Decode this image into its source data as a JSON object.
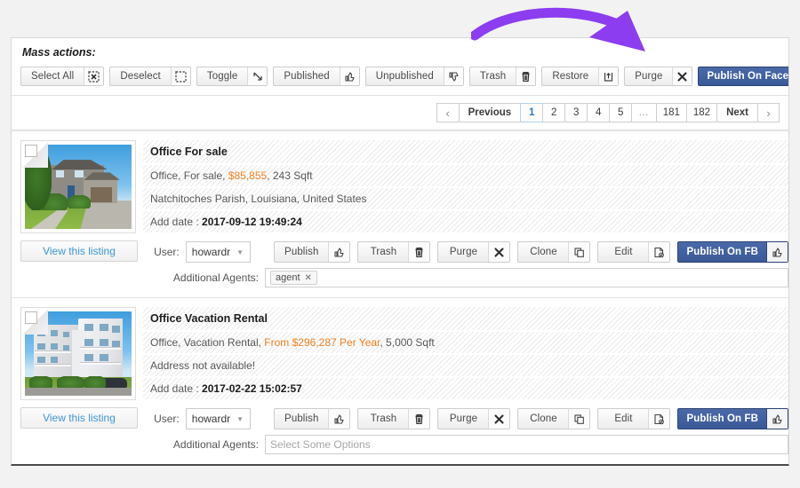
{
  "annotation": {
    "arrow_color": "#8b3def",
    "name": "purple-curved-arrow-pointing-to-publish-on-facebook"
  },
  "mass_actions": {
    "title": "Mass actions:",
    "buttons": [
      {
        "label": "Select All",
        "icon": "dotted-box-with-x-icon"
      },
      {
        "label": "Deselect",
        "icon": "dotted-empty-box-icon"
      },
      {
        "label": "Toggle",
        "icon": "diagonal-arrow-icon"
      },
      {
        "label": "Published",
        "icon": "thumbs-up-icon"
      },
      {
        "label": "Unpublished",
        "icon": "thumbs-down-icon"
      },
      {
        "label": "Trash",
        "icon": "trash-can-icon"
      },
      {
        "label": "Restore",
        "icon": "restore-up-arrow-icon"
      },
      {
        "label": "Purge",
        "icon": "x-mark-icon"
      },
      {
        "label": "Publish On Facebook",
        "icon": "thumbs-up-icon",
        "primary": true
      }
    ]
  },
  "pagination": {
    "previous_label": "Previous",
    "next_label": "Next",
    "pages": [
      "1",
      "2",
      "3",
      "4",
      "5",
      "…",
      "181",
      "182"
    ],
    "active_page": "1",
    "prev_arrow": "‹",
    "next_arrow": "›"
  },
  "listings": [
    {
      "title": "Office For sale",
      "summary_prefix": "Office, For sale, ",
      "price": "$85,855",
      "summary_suffix": ", 243 Sqft",
      "address": "Natchitoches Parish, Louisiana, United States",
      "date_label": "Add date : ",
      "date_value": "2017-09-12 19:49:24",
      "view_label": "View this listing",
      "thumb_alt": "two-story-suburban-house-photo",
      "user_label": "User:",
      "user_value": "howardr",
      "agents_label": "Additional Agents:",
      "agents_tag": "agent",
      "agents_tag_remove": "✕",
      "agents_placeholder": "",
      "actions": [
        {
          "label": "Publish",
          "icon": "thumbs-up-icon"
        },
        {
          "label": "Trash",
          "icon": "trash-can-icon"
        },
        {
          "label": "Purge",
          "icon": "x-mark-icon"
        },
        {
          "label": "Clone",
          "icon": "copy-pages-icon"
        },
        {
          "label": "Edit",
          "icon": "edit-document-icon"
        },
        {
          "label": "Publish On FB",
          "icon": "thumbs-up-icon",
          "primary": true
        }
      ]
    },
    {
      "title": "Office Vacation Rental",
      "summary_prefix": "Office, Vacation Rental, ",
      "price": "From $296,287 Per Year",
      "summary_suffix": ", 5,000 Sqft",
      "address": "Address not available!",
      "date_label": "Add date : ",
      "date_value": "2017-02-22 15:02:57",
      "view_label": "View this listing",
      "thumb_alt": "modern-white-apartment-building-photo",
      "user_label": "User:",
      "user_value": "howardr",
      "agents_label": "Additional Agents:",
      "agents_tag": "",
      "agents_tag_remove": "",
      "agents_placeholder": "Select Some Options",
      "actions": [
        {
          "label": "Publish",
          "icon": "thumbs-up-icon"
        },
        {
          "label": "Trash",
          "icon": "trash-can-icon"
        },
        {
          "label": "Purge",
          "icon": "x-mark-icon"
        },
        {
          "label": "Clone",
          "icon": "copy-pages-icon"
        },
        {
          "label": "Edit",
          "icon": "edit-document-icon"
        },
        {
          "label": "Publish On FB",
          "icon": "thumbs-up-icon",
          "primary": true
        }
      ]
    }
  ],
  "colors": {
    "facebook_blue": "#3b5998",
    "price_orange": "#f08020",
    "link_blue": "#3f96d8",
    "active_page_blue": "#2f78c4"
  }
}
